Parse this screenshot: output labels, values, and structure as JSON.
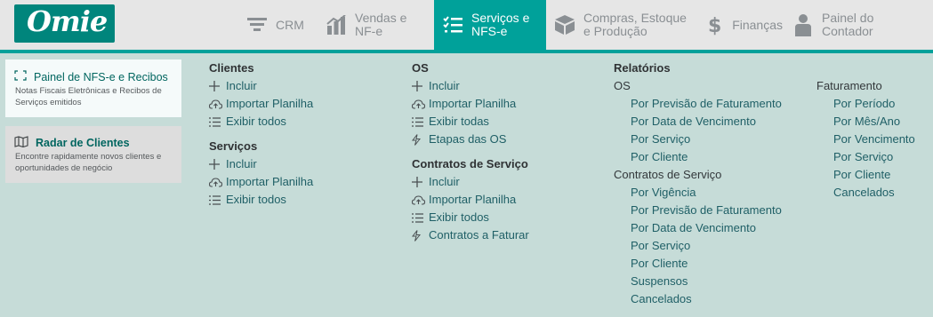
{
  "logo": {
    "text": "Omie"
  },
  "nav": [
    {
      "label": "CRM",
      "icon": "funnel-icon",
      "active": false
    },
    {
      "label": "Vendas e NF-e",
      "icon": "bar-chart-icon",
      "active": false
    },
    {
      "label": "Serviços e NFS-e",
      "icon": "checklist-icon",
      "active": true
    },
    {
      "label": "Compras, Estoque e Produção",
      "icon": "box-icon",
      "active": false
    },
    {
      "label": "Finanças",
      "icon": "dollar-icon",
      "active": false
    },
    {
      "label": "Painel do Contador",
      "icon": "person-icon",
      "active": false
    }
  ],
  "cards": [
    {
      "title": "Painel de NFS-e e Recibos",
      "description": "Notas Fiscais Eletrônicas e Recibos de Serviços emitidos",
      "icon": "expand-icon"
    },
    {
      "title": "Radar de Clientes",
      "description": "Encontre rapidamente novos clientes e oportunidades de negócio",
      "icon": "map-icon"
    }
  ],
  "menu": {
    "clientes": {
      "heading": "Clientes",
      "items": [
        "Incluir",
        "Importar Planilha",
        "Exibir todos"
      ]
    },
    "servicos": {
      "heading": "Serviços",
      "items": [
        "Incluir",
        "Importar Planilha",
        "Exibir todos"
      ]
    },
    "os": {
      "heading": "OS",
      "items": [
        "Incluir",
        "Importar Planilha",
        "Exibir todas",
        "Etapas das OS"
      ]
    },
    "contratos": {
      "heading": "Contratos de Serviço",
      "items": [
        "Incluir",
        "Importar Planilha",
        "Exibir todos",
        "Contratos a Faturar"
      ]
    },
    "relatorios": {
      "heading": "Relatórios",
      "os_label": "OS",
      "os_items": [
        "Por Previsão de Faturamento",
        "Por Data de Vencimento",
        "Por Serviço",
        "Por Cliente"
      ],
      "contratos_label": "Contratos de Serviço",
      "contratos_items": [
        "Por Vigência",
        "Por Previsão de Faturamento",
        "Por Data de Vencimento",
        "Por Serviço",
        "Por Cliente",
        "Suspensos",
        "Cancelados"
      ],
      "faturamento_label": "Faturamento",
      "faturamento_items": [
        "Por Período",
        "Por Mês/Ano",
        "Por Vencimento",
        "Por Serviço",
        "Por Cliente",
        "Cancelados"
      ]
    }
  },
  "colors": {
    "accent": "#00a19a",
    "logo_bg": "#00857c",
    "panel_bg": "#c6dcd8",
    "link": "#1f5f66"
  }
}
